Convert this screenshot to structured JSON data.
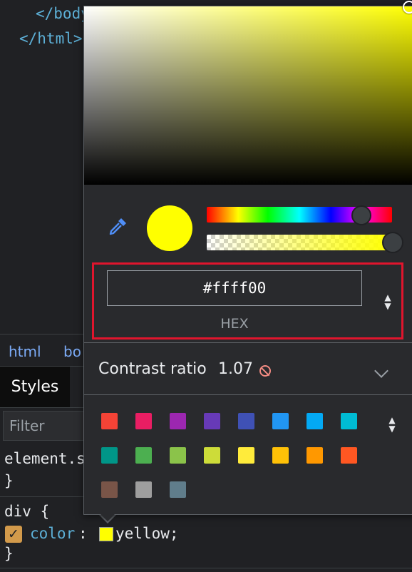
{
  "code": {
    "lines": [
      "</body>",
      "</html>"
    ]
  },
  "breadcrumb": {
    "items": [
      "html",
      "bo"
    ]
  },
  "tabs": {
    "styles": "Styles"
  },
  "filter": {
    "placeholder": "Filter"
  },
  "rules": {
    "element_selector": "element.s",
    "element_close": "}",
    "div_selector": "div {",
    "property_name": "color",
    "colon": ":",
    "property_value": "yellow;",
    "div_close": "}"
  },
  "picker": {
    "current_color": "#ffff00",
    "hue_position_fraction": 0.833,
    "alpha": 1.0,
    "hex_value": "#ffff00",
    "format_label": "HEX",
    "contrast_label": "Contrast ratio",
    "contrast_value": "1.07",
    "contrast_icon": "no-icon",
    "expand_icon": "chevron-down-icon",
    "eyedropper_icon": "eyedropper-icon",
    "palette_colors": [
      "#f44336",
      "#e91e63",
      "#9c27b0",
      "#673ab7",
      "#3f51b5",
      "#2196f3",
      "#03a9f4",
      "#00bcd4",
      "#009688",
      "#4caf50",
      "#8bc34a",
      "#cddc39",
      "#ffeb3b",
      "#ffc107",
      "#ff9800",
      "#ff5722",
      "#795548",
      "#9e9e9e",
      "#607d8b"
    ]
  },
  "accent": {
    "highlight_border": "#e0152d"
  }
}
